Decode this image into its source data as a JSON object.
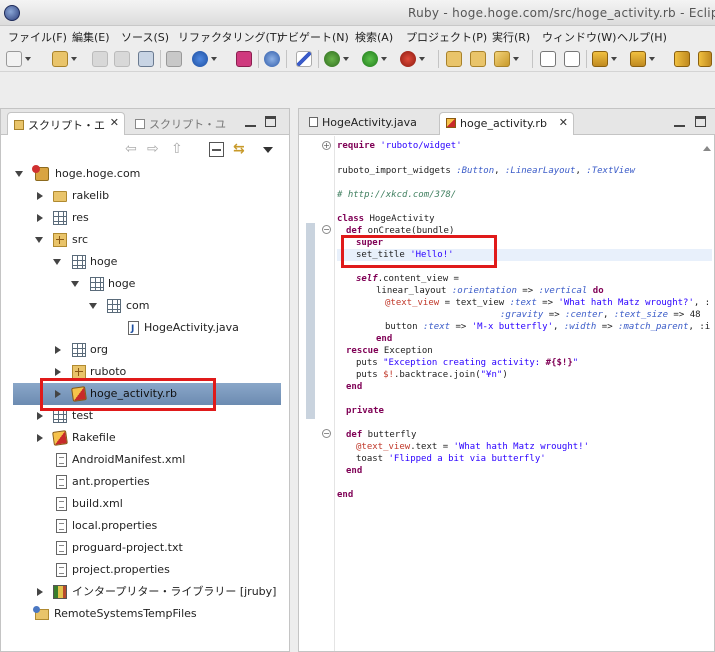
{
  "window": {
    "title": "Ruby - hoge.hoge.com/src/hoge_activity.rb - Eclip"
  },
  "menu": [
    {
      "label": "ファイル(F)"
    },
    {
      "label": "編集(E)"
    },
    {
      "label": "ソース(S)"
    },
    {
      "label": "リファクタリング(T)"
    },
    {
      "label": "ナビゲート(N)"
    },
    {
      "label": "検索(A)"
    },
    {
      "label": "プロジェクト(P)"
    },
    {
      "label": "実行(R)"
    },
    {
      "label": "ウィンドウ(W)"
    },
    {
      "label": "ヘルプ(H)"
    }
  ],
  "left_panel": {
    "active_tab": "スクリプト・エ",
    "inactive_tab": "スクリプト・ユ",
    "tree": [
      {
        "label": "hoge.hoge.com",
        "icon": "project-icon"
      },
      {
        "label": "rakelib",
        "icon": "folder-icon"
      },
      {
        "label": "res",
        "icon": "package-icon"
      },
      {
        "label": "src",
        "icon": "source-folder-icon"
      },
      {
        "label": "hoge",
        "icon": "package-icon"
      },
      {
        "label": "hoge",
        "icon": "package-icon"
      },
      {
        "label": "com",
        "icon": "package-icon"
      },
      {
        "label": "HogeActivity.java",
        "icon": "java-file-icon"
      },
      {
        "label": "org",
        "icon": "package-icon"
      },
      {
        "label": "ruboto",
        "icon": "source-folder-icon"
      },
      {
        "label": "hoge_activity.rb",
        "icon": "ruby-file-icon"
      },
      {
        "label": "test",
        "icon": "package-icon"
      },
      {
        "label": "Rakefile",
        "icon": "ruby-file-icon"
      },
      {
        "label": "AndroidManifest.xml",
        "icon": "file-icon"
      },
      {
        "label": "ant.properties",
        "icon": "file-icon"
      },
      {
        "label": "build.xml",
        "icon": "file-icon"
      },
      {
        "label": "local.properties",
        "icon": "file-icon"
      },
      {
        "label": "proguard-project.txt",
        "icon": "file-icon"
      },
      {
        "label": "project.properties",
        "icon": "file-icon"
      },
      {
        "label": "インタープリター・ライブラリー [jruby]",
        "icon": "library-icon"
      },
      {
        "label": "RemoteSystemsTempFiles",
        "icon": "remote-folder-icon"
      }
    ]
  },
  "editor": {
    "tabs": [
      {
        "label": "HogeActivity.java"
      },
      {
        "label": "hoge_activity.rb"
      }
    ],
    "code": {
      "l1_kw": "require",
      "l1_str": "'ruboto/widget'",
      "l2_plain": "ruboto_import_widgets ",
      "l2_s1": ":Button",
      "l2_s2": ":LinearLayout",
      "l2_s3": ":TextView",
      "l3_cm": "# http://xkcd.com/378/",
      "l4_kw": "class",
      "l4_plain": " HogeActivity",
      "l5_kw": "def",
      "l5_plain": " onCreate(bundle)",
      "l6_kw": "super",
      "l7_plain": "set_title ",
      "l7_str": "'Hello!'",
      "l8_kw": "self",
      "l8_plain": ".content_view =",
      "l9_plain": "linear_layout ",
      "l9_sym": ":orientation",
      "l9_arrow": " => ",
      "l9_sym2": ":vertical",
      "l9_kw": " do",
      "l10_ivar": "@text_view",
      "l10_plain": " = text_view ",
      "l10_sym": ":text",
      "l10_arrow": " => ",
      "l10_str": "'What hath Matz wrought?'",
      "l10_tail": ", :",
      "l11_sym": ":gravity",
      "l11_arrow": " => ",
      "l11_sym2": ":center",
      "l11_sep": ", ",
      "l11_sym3": ":text_size",
      "l11_tail": " => 48",
      "l12_plain": "button ",
      "l12_sym": ":text",
      "l12_arrow": " => ",
      "l12_str": "'M-x butterfly'",
      "l12_sep": ", ",
      "l12_sym2": ":width",
      "l12_arrow2": " => ",
      "l12_sym3": ":match_parent",
      "l12_tail": ", :i",
      "l13_kw": "end",
      "l14_kw": "rescue",
      "l14_plain": " Exception",
      "l15_plain": "puts ",
      "l15_str": "\"Exception creating activity: ",
      "l15_interp": "#{$!}",
      "l15_str2": "\"",
      "l16_plain": "puts ",
      "l16_ivar": "$!",
      "l16_plain2": ".backtrace.join(",
      "l16_str": "\"¥n\"",
      "l16_plain3": ")",
      "l17_kw": "end",
      "l18_kw": "private",
      "l19_kw": "def",
      "l19_plain": " butterfly",
      "l20_ivar": "@text_view",
      "l20_plain": ".text = ",
      "l20_str": "'What hath Matz wrought!'",
      "l21_plain": "toast ",
      "l21_str": "'Flipped a bit via butterfly'",
      "l22_kw": "end",
      "l23_kw": "end"
    }
  }
}
